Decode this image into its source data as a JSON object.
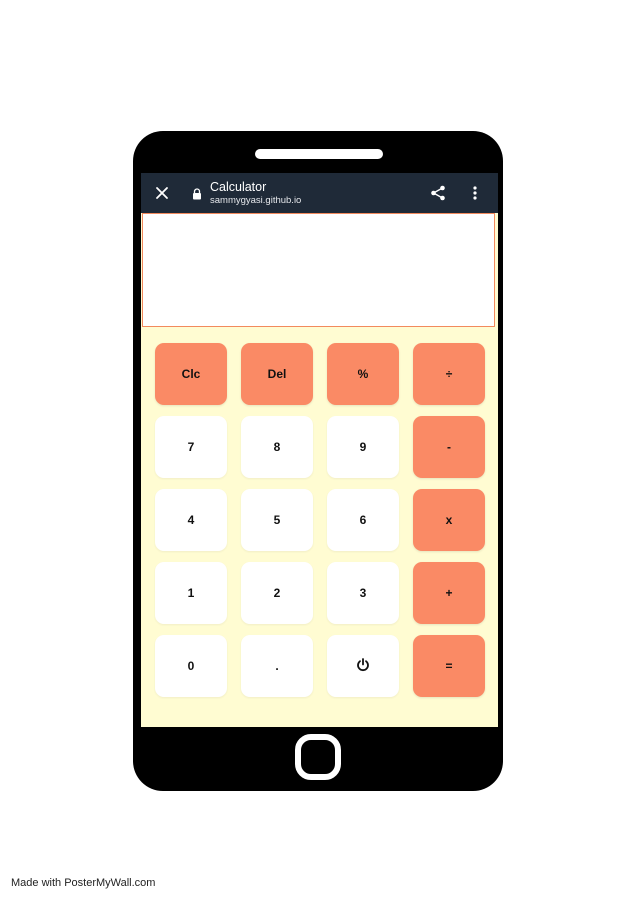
{
  "browser": {
    "title": "Calculator",
    "url": "sammygyasi.github.io"
  },
  "display": {
    "value": ""
  },
  "keys": {
    "clc": "Clc",
    "del": "Del",
    "percent": "%",
    "divide": "÷",
    "seven": "7",
    "eight": "8",
    "nine": "9",
    "minus": "-",
    "four": "4",
    "five": "5",
    "six": "6",
    "multiply": "x",
    "one": "1",
    "two": "2",
    "three": "3",
    "plus": "+",
    "zero": "0",
    "dot": ".",
    "power": "power-icon",
    "equals": "="
  },
  "colors": {
    "accent": "#fa8a65",
    "keypad_background": "#fffcd2",
    "browser_bar": "#1f2a38",
    "display_border": "#f28a5e"
  },
  "icons": [
    "close-icon",
    "lock-icon",
    "share-icon",
    "more-vert-icon",
    "power-icon"
  ],
  "footer": {
    "watermark": "Made with PosterMyWall.com"
  }
}
